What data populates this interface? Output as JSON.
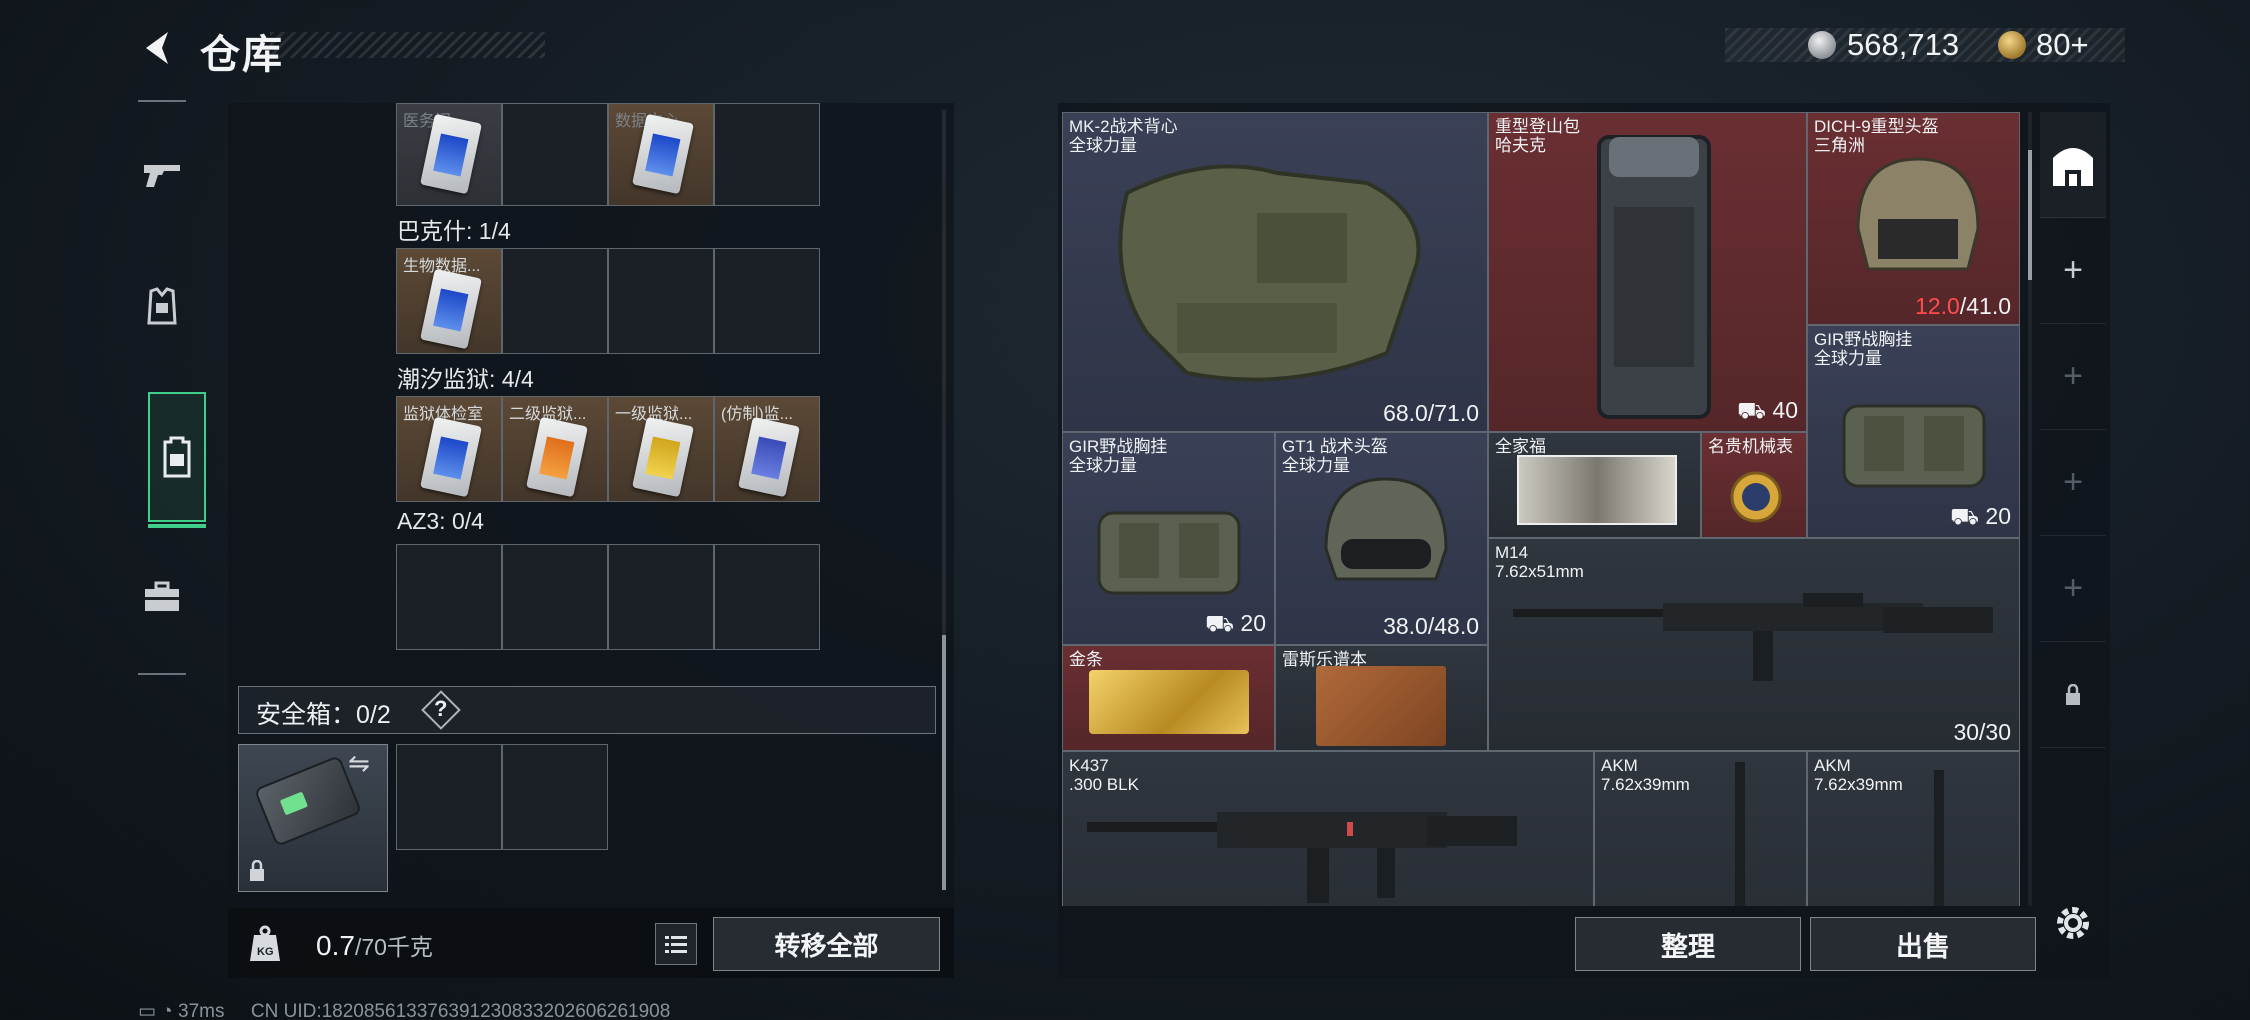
{
  "header": {
    "title": "仓库"
  },
  "currency": {
    "silver": "568,713",
    "gold": "80+"
  },
  "nav": {
    "items": [
      "weapons",
      "armor",
      "backpack",
      "toolbox"
    ]
  },
  "left": {
    "top_row_labels": [
      "医务间",
      "数据中心"
    ],
    "groups": [
      {
        "label": "巴克什: 1/4",
        "cells": [
          "生物数据..."
        ]
      },
      {
        "label": "潮汐监狱: 4/4",
        "cells": [
          "监狱体检室",
          "二级监狱...",
          "一级监狱...",
          "(仿制)监..."
        ]
      },
      {
        "label": "AZ3: 0/4",
        "cells": []
      }
    ],
    "safe_box": {
      "label": "安全箱：0/2",
      "help": "?"
    },
    "weight": {
      "value": "0.7",
      "unit": "/70千克"
    },
    "transfer_all": "转移全部"
  },
  "items": [
    {
      "name": "MK-2战术背心",
      "sub": "全球力量",
      "stat": "68.0/71.0",
      "color": "navy"
    },
    {
      "name": "重型登山包",
      "sub": "哈夫克",
      "stat": "40",
      "color": "red"
    },
    {
      "name": "DICH-9重型头盔",
      "sub": "三角洲",
      "stat_red": "12.0",
      "stat": "/41.0",
      "color": "red"
    },
    {
      "name": "GIR野战胸挂",
      "sub": "全球力量",
      "stat": "20",
      "color": "navy"
    },
    {
      "name": "GIR野战胸挂",
      "sub": "全球力量",
      "stat": "20",
      "color": "navy"
    },
    {
      "name": "GT1 战术头盔",
      "sub": "全球力量",
      "stat": "38.0/48.0",
      "color": "navy"
    },
    {
      "name": "全家福",
      "sub": "",
      "stat": "",
      "color": "dark"
    },
    {
      "name": "名贵机械表",
      "sub": "",
      "stat": "",
      "color": "red"
    },
    {
      "name": "M14",
      "sub": "7.62x51mm",
      "stat": "30/30",
      "color": "dark"
    },
    {
      "name": "金条",
      "sub": "",
      "stat": "",
      "color": "red"
    },
    {
      "name": "雷斯乐谱本",
      "sub": "",
      "stat": "",
      "color": "dark"
    },
    {
      "name": "K437",
      "sub": ".300 BLK",
      "stat": "",
      "color": "dark"
    },
    {
      "name": "AKM",
      "sub": "7.62x39mm",
      "stat": "",
      "color": "dark"
    },
    {
      "name": "AKM",
      "sub": "7.62x39mm",
      "stat": "",
      "color": "dark"
    }
  ],
  "actions": {
    "sort": "整理",
    "sell": "出售"
  },
  "footer": {
    "ping": "37ms",
    "uid": "CN UID:18208561337639123083320260626190​8"
  },
  "colors": {
    "accent": "#3fcf8a",
    "item_red": "#6a2f33",
    "item_navy": "#3a4056"
  }
}
